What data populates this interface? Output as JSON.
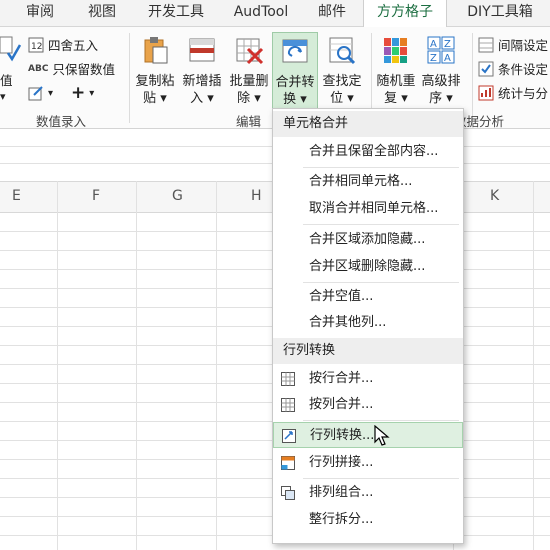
{
  "tabs": [
    "审阅",
    "视图",
    "开发工具",
    "AudTool",
    "邮件",
    "方方格子",
    "DIY工具箱"
  ],
  "ribbon": {
    "left_partial": "值",
    "round_label": "四舍五入",
    "keep_numbers_label": "只保留数值",
    "data_entry_group": "数值录入",
    "copy_paste": [
      "复制粘",
      "贴"
    ],
    "batch_insert": [
      "新增插",
      "入"
    ],
    "batch_delete": [
      "批量删",
      "除"
    ],
    "merge_convert": [
      "合并转",
      "换"
    ],
    "find_locate": [
      "查找定",
      "位"
    ],
    "random_repeat": [
      "随机重",
      "复"
    ],
    "advanced_sort": [
      "高级排",
      "序"
    ],
    "edit_group": "编辑",
    "interval_setting": "间隔设定",
    "condition_setting": "条件设定",
    "stats_label": "统计与分",
    "data_analysis_group": "数据分析"
  },
  "columns": [
    "E",
    "F",
    "G",
    "H",
    "K"
  ],
  "menu": {
    "section1": "单元格合并",
    "items1": [
      "合并且保留全部内容...",
      "合并相同单元格...",
      "取消合并相同单元格...",
      "合并区域添加隐藏...",
      "合并区域删除隐藏...",
      "合并空值...",
      "合并其他列..."
    ],
    "section2": "行列转换",
    "items2": [
      "按行合并...",
      "按列合并...",
      "行列转换...",
      "行列拼接...",
      "排列组合...",
      "整行拆分..."
    ]
  },
  "colors": {
    "accent_green": "#1d6f42",
    "highlight": "#dff0e1"
  }
}
